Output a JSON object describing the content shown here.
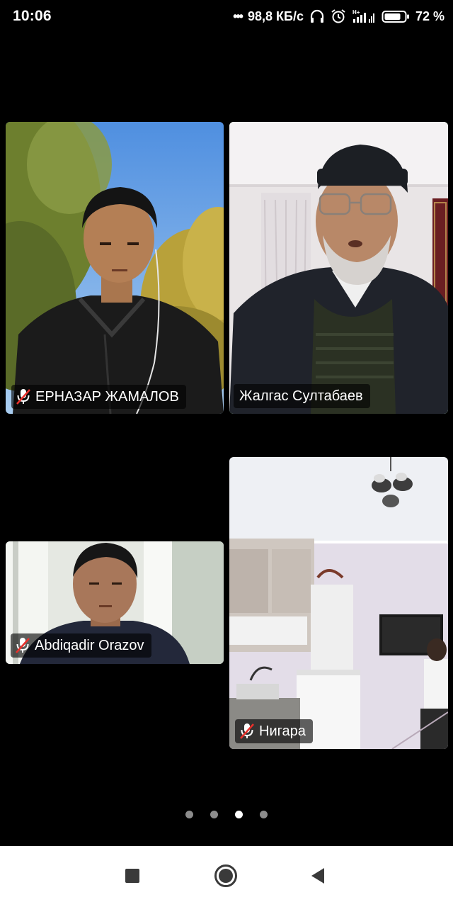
{
  "status_bar": {
    "time": "10:06",
    "dots": "•••",
    "net_speed": "98,8 КБ/с",
    "battery_percent": "72 %",
    "icons": [
      "headphones-icon",
      "alarm-icon",
      "signal-icon",
      "battery-icon"
    ]
  },
  "participants": [
    {
      "name": "ЕРНАЗАР ЖАМАЛОВ",
      "muted": true,
      "active_speaker": false
    },
    {
      "name": "Жалгас Султабаев",
      "muted": false,
      "active_speaker": true
    },
    {
      "name": "Abdiqadir Orazov",
      "muted": true,
      "active_speaker": false
    },
    {
      "name": "Нигара",
      "muted": true,
      "active_speaker": false
    }
  ],
  "pager": {
    "total": 4,
    "current": 3
  },
  "nav_bar": {
    "icons": [
      "recents-square-icon",
      "home-circle-icon",
      "back-triangle-icon"
    ]
  },
  "colors": {
    "active_speaker_border": "#3fce4f",
    "background": "#000000"
  }
}
